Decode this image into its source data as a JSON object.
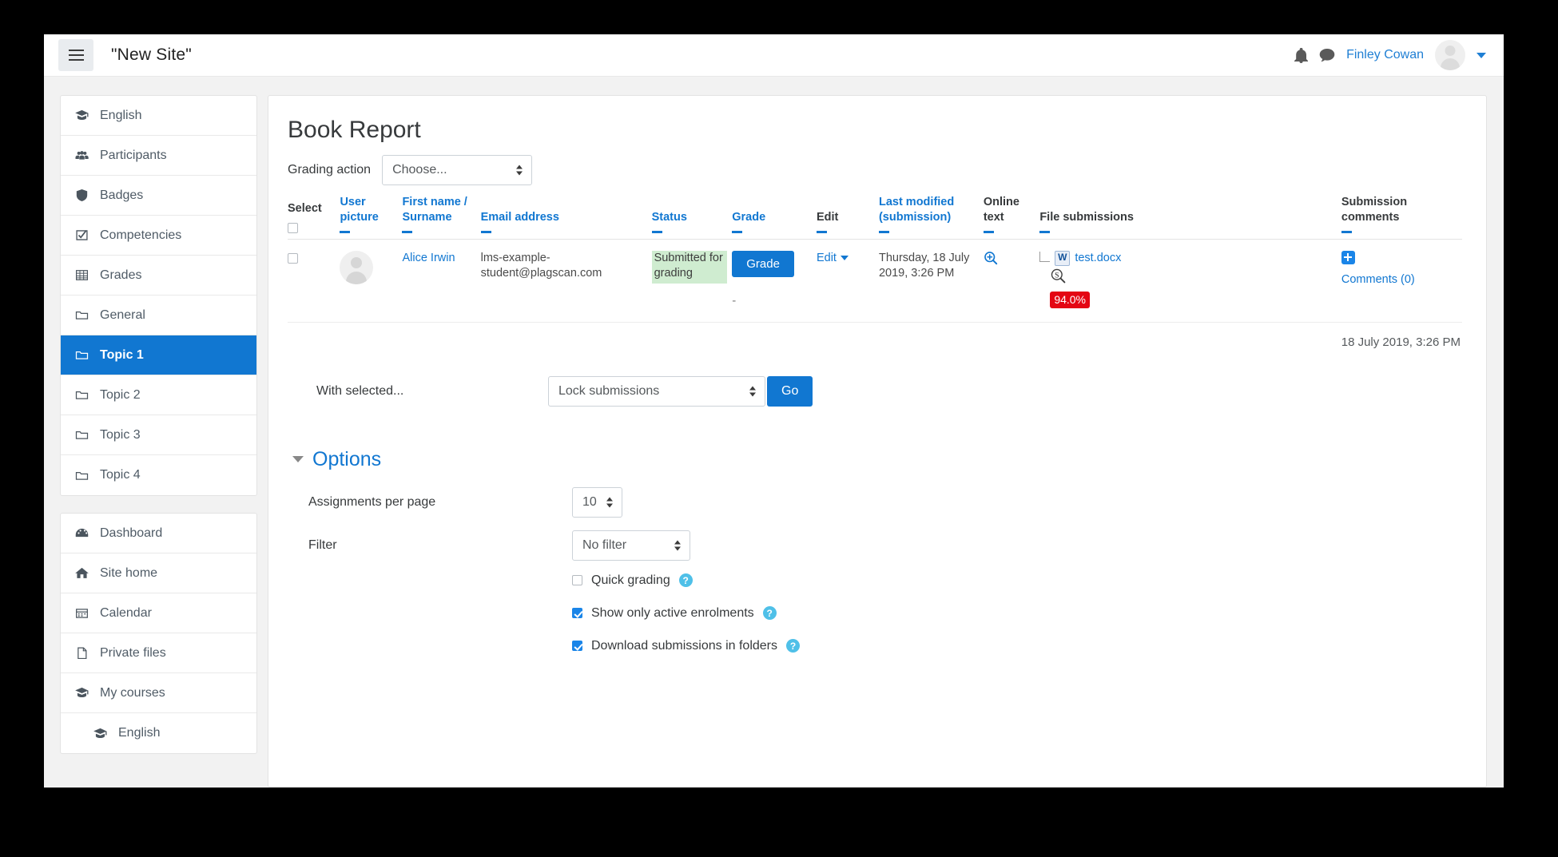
{
  "navbar": {
    "menu_icon": "hamburger-icon",
    "site_title": "\"New Site\"",
    "notifications_icon": "bell-icon",
    "messages_icon": "message-bubble-icon",
    "user_name": "Finley Cowan",
    "avatar": "user-avatar",
    "caret": "chevron-down-icon"
  },
  "sidebar": {
    "course_block": [
      {
        "label": "English",
        "icon": "graduation-cap-icon",
        "active": false
      },
      {
        "label": "Participants",
        "icon": "users-icon",
        "active": false
      },
      {
        "label": "Badges",
        "icon": "shield-icon",
        "active": false
      },
      {
        "label": "Competencies",
        "icon": "check-square-icon",
        "active": false
      },
      {
        "label": "Grades",
        "icon": "table-icon",
        "active": false
      },
      {
        "label": "General",
        "icon": "folder-icon",
        "active": false
      },
      {
        "label": "Topic 1",
        "icon": "folder-icon",
        "active": true
      },
      {
        "label": "Topic 2",
        "icon": "folder-icon",
        "active": false
      },
      {
        "label": "Topic 3",
        "icon": "folder-icon",
        "active": false
      },
      {
        "label": "Topic 4",
        "icon": "folder-icon",
        "active": false
      }
    ],
    "site_block": [
      {
        "label": "Dashboard",
        "icon": "dashboard-icon",
        "indent": false
      },
      {
        "label": "Site home",
        "icon": "home-icon",
        "indent": false
      },
      {
        "label": "Calendar",
        "icon": "calendar-icon",
        "indent": false
      },
      {
        "label": "Private files",
        "icon": "file-icon",
        "indent": false
      },
      {
        "label": "My courses",
        "icon": "graduation-cap-icon",
        "indent": false
      },
      {
        "label": "English",
        "icon": "graduation-cap-icon",
        "indent": true
      }
    ]
  },
  "main": {
    "page_title": "Book Report",
    "grading_action": {
      "label": "Grading action",
      "selected": "Choose..."
    },
    "table": {
      "headers": [
        {
          "label": "Select",
          "link": false,
          "sort": false
        },
        {
          "label": "User picture",
          "link": true,
          "sort": true
        },
        {
          "label": "First name / Surname",
          "link": true,
          "sort": true
        },
        {
          "label": "Email address",
          "link": true,
          "sort": true
        },
        {
          "label": "Status",
          "link": true,
          "sort": true
        },
        {
          "label": "Grade",
          "link": true,
          "sort": true
        },
        {
          "label": "Edit",
          "link": false,
          "sort": true
        },
        {
          "label": "Last modified (submission)",
          "link": true,
          "sort": true
        },
        {
          "label": "Online text",
          "link": false,
          "sort": true
        },
        {
          "label": "File submissions",
          "link": false,
          "sort": true
        },
        {
          "label": "Submission comments",
          "link": false,
          "sort": true
        }
      ],
      "rows": [
        {
          "selected": false,
          "student_name": "Alice Irwin",
          "email": "lms-example-student@plagscan.com",
          "status": "Submitted for grading",
          "grade_button": "Grade",
          "grade_value": "-",
          "edit_label": "Edit",
          "last_modified": "Thursday, 18 July 2019, 3:26 PM",
          "online_text_icon": "magnifier-plus-icon",
          "file_name": "test.docx",
          "file_icon": "word-document-icon",
          "plagiarism_icon": "plagscan-magnifier-icon",
          "plagiarism_score": "94.0%",
          "comments_label": "Comments (0)",
          "comments_icon": "plus-square-icon"
        }
      ],
      "footer_timestamp": "18 July 2019, 3:26 PM"
    },
    "with_selected": {
      "label": "With selected...",
      "selected_action": "Lock submissions",
      "go_label": "Go"
    },
    "options": {
      "title": "Options",
      "collapse_icon": "caret-down-icon",
      "assignments_per_page_label": "Assignments per page",
      "assignments_per_page_value": "10",
      "filter_label": "Filter",
      "filter_value": "No filter",
      "checkboxes": [
        {
          "label": "Quick grading",
          "checked": false,
          "help": "?"
        },
        {
          "label": "Show only active enrolments",
          "checked": true,
          "help": "?"
        },
        {
          "label": "Download submissions in folders",
          "checked": true,
          "help": "?"
        }
      ]
    }
  },
  "colors": {
    "accent_blue": "#1177d1",
    "link_blue": "#1f7fd4",
    "status_green_bg": "#cfecd0",
    "plagiarism_red": "#e40613",
    "help_blue": "#4fc0e8"
  }
}
